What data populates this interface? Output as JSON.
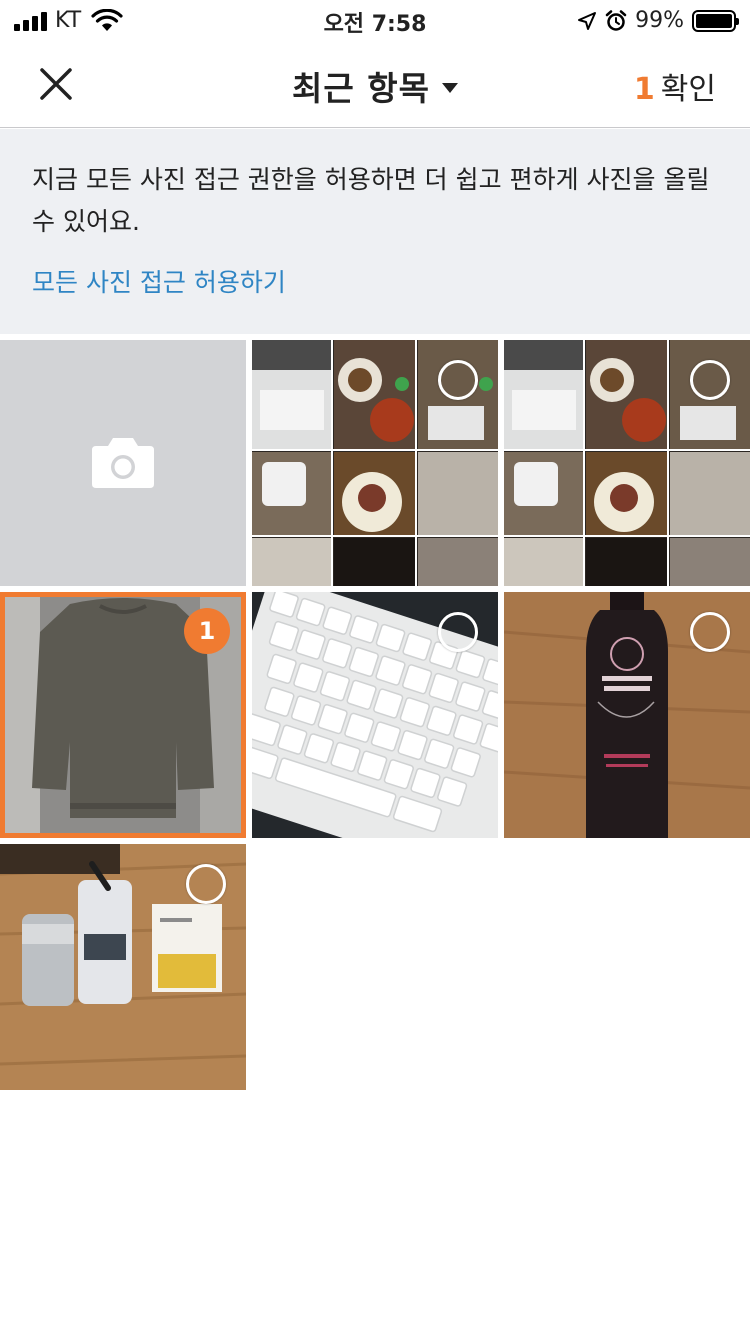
{
  "status_bar": {
    "carrier": "KT",
    "time": "오전 7:58",
    "battery_percent": "99%",
    "battery_level": 0.99,
    "icons": [
      "signal-icon",
      "wifi-icon",
      "location-icon",
      "alarm-icon",
      "battery-icon"
    ]
  },
  "nav": {
    "close_icon": "close-icon",
    "title": "최근 항목",
    "confirm_count": "1",
    "confirm_label": "확인"
  },
  "banner": {
    "message": "지금 모든 사진 접근 권한을 허용하면 더 쉽고 편하게 사진을 올릴 수 있어요.",
    "link": "모든 사진 접근 허용하기"
  },
  "grid": {
    "camera_icon": "camera-icon",
    "photos": [
      {
        "subject": "screenshot-collage",
        "selected": false
      },
      {
        "subject": "screenshot-collage",
        "selected": false
      },
      {
        "subject": "knit-sweater",
        "selected": true,
        "order": "1"
      },
      {
        "subject": "keyboard",
        "selected": false
      },
      {
        "subject": "shampoo-bottle",
        "selected": false
      },
      {
        "subject": "cans-on-floor",
        "selected": false
      }
    ]
  },
  "colors": {
    "accent": "#f07b31",
    "link": "#2f85c4",
    "banner_bg": "#eef0f3",
    "camera_tile_bg": "#d2d3d6"
  }
}
